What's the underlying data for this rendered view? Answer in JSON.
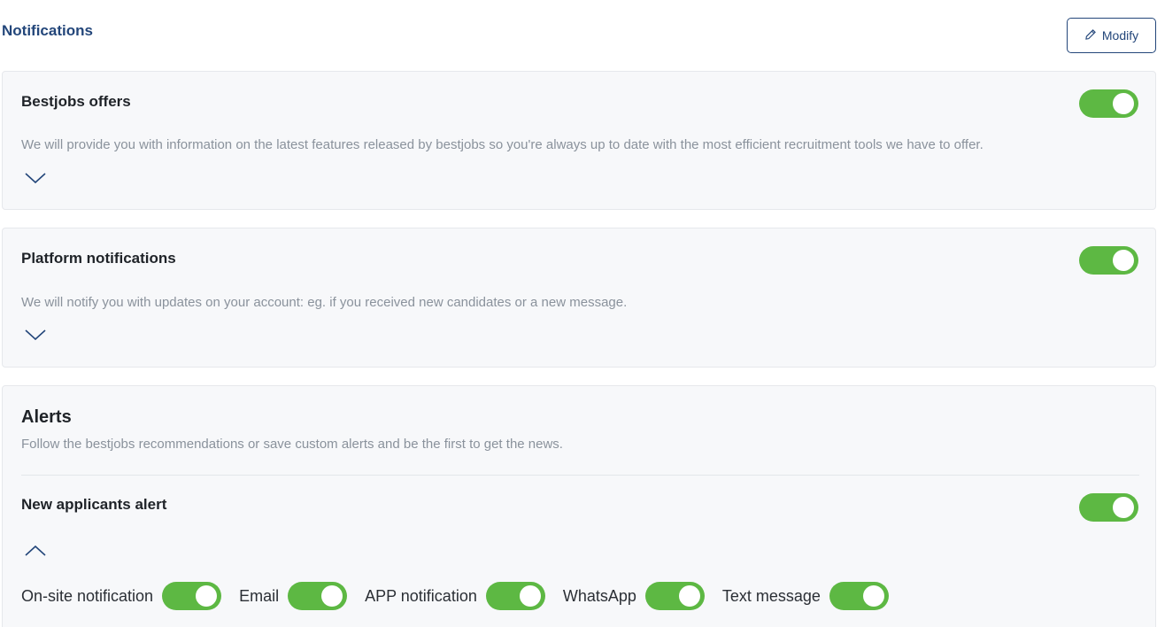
{
  "header": {
    "title": "Notifications",
    "modify_label": "Modify"
  },
  "cards": [
    {
      "title": "Bestjobs offers",
      "description": "We will provide you with information on the latest features released by bestjobs so you're always up to date with the most efficient recruitment tools we have to offer.",
      "enabled": true,
      "expanded": false
    },
    {
      "title": "Platform notifications",
      "description": "We will notify you with updates on your account: eg. if you received new candidates or a new message.",
      "enabled": true,
      "expanded": false
    }
  ],
  "alerts": {
    "title": "Alerts",
    "description": "Follow the bestjobs recommendations or save custom alerts and be the first to get the news.",
    "new_applicants": {
      "title": "New applicants alert",
      "enabled": true,
      "expanded": true
    },
    "channels": [
      {
        "label": "On-site notification",
        "enabled": true
      },
      {
        "label": "Email",
        "enabled": true
      },
      {
        "label": "APP notification",
        "enabled": true
      },
      {
        "label": "WhatsApp",
        "enabled": true
      },
      {
        "label": "Text message",
        "enabled": true
      }
    ]
  },
  "colors": {
    "accent": "#23467a",
    "toggle_on": "#5db843",
    "card_bg": "#f7f8fa",
    "muted_text": "#8a929c"
  },
  "icons": {
    "modify": "pencil-icon",
    "collapsed": "chevron-down-icon",
    "expanded": "chevron-up-icon"
  }
}
